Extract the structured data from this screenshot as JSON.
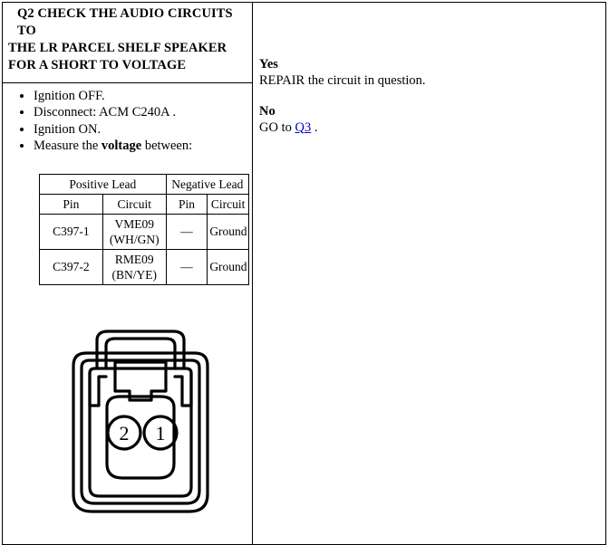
{
  "question": {
    "id": "Q2",
    "title_line1": "Q2 CHECK THE AUDIO CIRCUITS TO",
    "title_line2": "THE LR PARCEL SHELF SPEAKER",
    "title_line3": "FOR A SHORT TO VOLTAGE"
  },
  "steps": {
    "item1": "Ignition OFF.",
    "item2": "Disconnect: ACM C240A .",
    "item3": "Ignition ON.",
    "item4_prefix": "Measure the ",
    "item4_bold": "voltage",
    "item4_suffix": " between:"
  },
  "lead_table": {
    "group_headers": {
      "positive": "Positive Lead",
      "negative": "Negative Lead"
    },
    "column_headers": {
      "pos_pin": "Pin",
      "pos_circuit": "Circuit",
      "neg_pin": "Pin",
      "neg_circuit": "Circuit"
    },
    "rows": [
      {
        "pos_pin": "C397-1",
        "pos_circuit_line1": "VME09",
        "pos_circuit_line2": "(WH/GN)",
        "neg_pin": "—",
        "neg_circuit": "Ground"
      },
      {
        "pos_pin": "C397-2",
        "pos_circuit_line1": "RME09",
        "pos_circuit_line2": "(BN/YE)",
        "neg_pin": "—",
        "neg_circuit": "Ground"
      }
    ]
  },
  "connector": {
    "name": "two-pin-connector-face-view",
    "pins": [
      {
        "label": "2"
      },
      {
        "label": "1"
      }
    ]
  },
  "answers": {
    "yes_label": "Yes",
    "yes_action": "REPAIR the circuit in question.",
    "no_label": "No",
    "no_action_prefix": "GO to ",
    "no_action_link": "Q3",
    "no_action_suffix": " ."
  },
  "colors": {
    "link": "#0000cc",
    "border": "#000000",
    "background": "#ffffff"
  }
}
